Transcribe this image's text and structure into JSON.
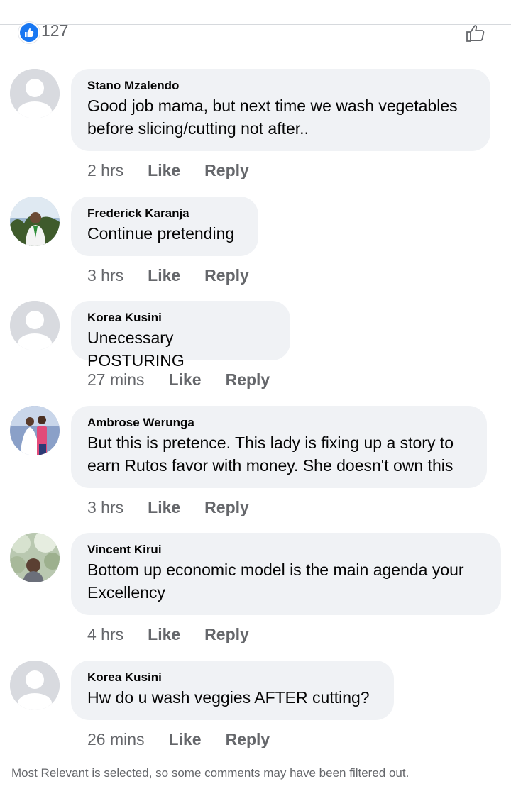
{
  "reactions": {
    "count": "127",
    "icon": "like-icon",
    "accent": "#1877f2"
  },
  "comments": [
    {
      "author": "Stano Mzalendo",
      "text": "Good job mama, but next time we wash vegetables before slicing/cutting not after..",
      "time": "2 hrs",
      "like_label": "Like",
      "reply_label": "Reply",
      "avatar": "default-avatar"
    },
    {
      "author": "Frederick Karanja",
      "text": "Continue pretending",
      "time": "3 hrs",
      "like_label": "Like",
      "reply_label": "Reply",
      "avatar": "photo-avatar"
    },
    {
      "author": "Korea Kusini",
      "text": "Unecessary POSTURING",
      "time": "27 mins",
      "like_label": "Like",
      "reply_label": "Reply",
      "avatar": "default-avatar"
    },
    {
      "author": "Ambrose Werunga",
      "text": "But this is pretence. This lady is fixing up a story to earn Rutos favor with money. She doesn't own this",
      "time": "3 hrs",
      "like_label": "Like",
      "reply_label": "Reply",
      "avatar": "photo-avatar"
    },
    {
      "author": "Vincent Kirui",
      "text": "Bottom up economic model is the main agenda your Excellency",
      "time": "4 hrs",
      "like_label": "Like",
      "reply_label": "Reply",
      "avatar": "photo-avatar"
    },
    {
      "author": "Korea Kusini",
      "text": "Hw do u wash veggies AFTER cutting?",
      "time": "26 mins",
      "like_label": "Like",
      "reply_label": "Reply",
      "avatar": "default-avatar"
    }
  ],
  "footer": {
    "note": "Most Relevant is selected, so some comments may have been filtered out."
  }
}
